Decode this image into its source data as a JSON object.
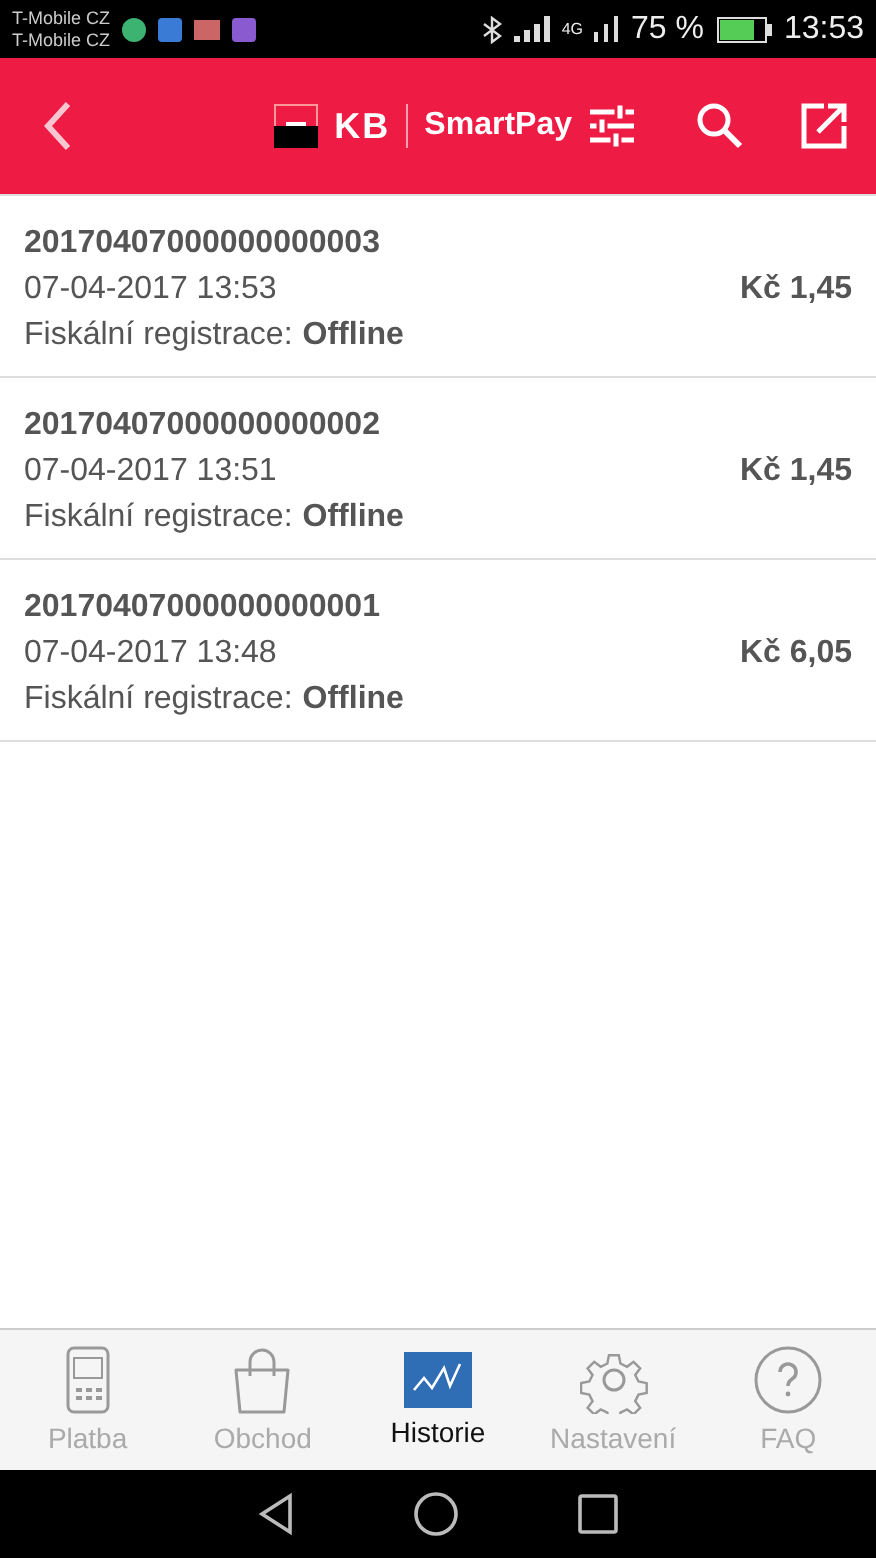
{
  "status_bar": {
    "carriers": [
      "T-Mobile CZ",
      "T-Mobile CZ"
    ],
    "network": "4G",
    "battery": "75 %",
    "time": "13:53"
  },
  "header": {
    "logo_mark": "KB",
    "app_name": "SmartPay"
  },
  "transactions": [
    {
      "id": "20170407000000000003",
      "date": "07-04-2017 13:53",
      "fiscal_label": "Fiskální registrace:",
      "fiscal_status": "Offline",
      "amount": "Kč 1,45"
    },
    {
      "id": "20170407000000000002",
      "date": "07-04-2017 13:51",
      "fiscal_label": "Fiskální registrace:",
      "fiscal_status": "Offline",
      "amount": "Kč 1,45"
    },
    {
      "id": "20170407000000000001",
      "date": "07-04-2017 13:48",
      "fiscal_label": "Fiskální registrace:",
      "fiscal_status": "Offline",
      "amount": "Kč 6,05"
    }
  ],
  "tabs": [
    {
      "kind": "terminal",
      "label": "Platba",
      "selected": false
    },
    {
      "kind": "shop",
      "label": "Obchod",
      "selected": false
    },
    {
      "kind": "history",
      "label": "Historie",
      "selected": true
    },
    {
      "kind": "settings",
      "label": "Nastavení",
      "selected": false
    },
    {
      "kind": "faq",
      "label": "FAQ",
      "selected": false
    }
  ]
}
